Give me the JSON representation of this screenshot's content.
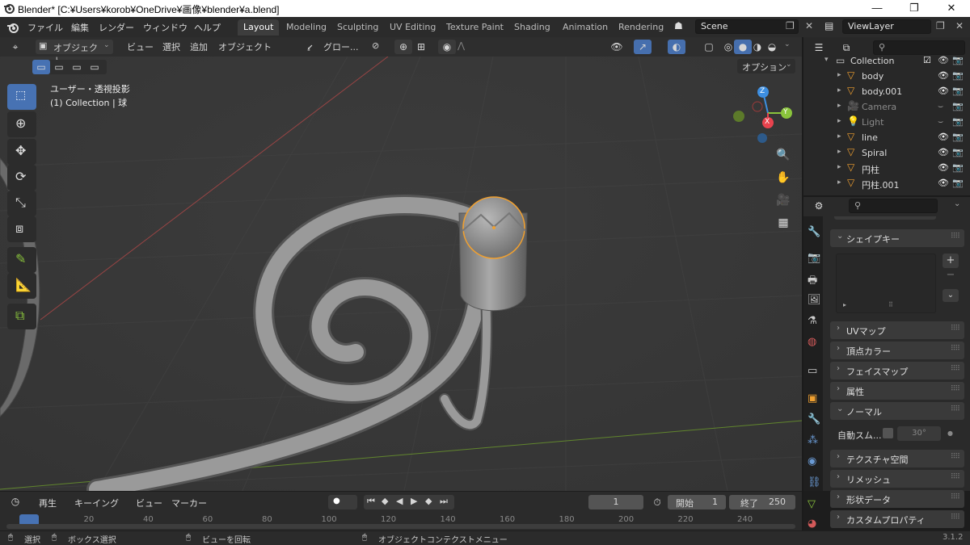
{
  "window": {
    "title": "Blender* [C:¥Users¥korob¥OneDrive¥画像¥blender¥a.blend]",
    "minimize": "—",
    "maximize": "❐",
    "close": "✕"
  },
  "menubar": {
    "items": [
      "ファイル",
      "編集",
      "レンダー",
      "ウィンドウ",
      "ヘルプ"
    ],
    "workspaces": [
      "Layout",
      "Modeling",
      "Sculpting",
      "UV Editing",
      "Texture Paint",
      "Shading",
      "Animation",
      "Rendering"
    ],
    "active_workspace": "Layout",
    "scene": "Scene",
    "view_layer": "ViewLayer"
  },
  "viewport_header": {
    "mode": "オブジェクト...",
    "menus": [
      "ビュー",
      "選択",
      "追加",
      "オブジェクト"
    ],
    "orientation": "グロー...",
    "options": "オプション"
  },
  "viewport": {
    "view_name": "ユーザー・透視投影",
    "collection_info": "(1) Collection | 球",
    "axis_x": "X",
    "axis_y": "Y",
    "axis_z": "Z"
  },
  "outliner": {
    "search_placeholder": "",
    "collection": "Collection",
    "rows": [
      {
        "name": "body",
        "dim": false
      },
      {
        "name": "body.001",
        "dim": false
      },
      {
        "name": "Camera",
        "dim": true
      },
      {
        "name": "Light",
        "dim": true
      },
      {
        "name": "line",
        "dim": false
      },
      {
        "name": "Spiral",
        "dim": false
      },
      {
        "name": "円柱",
        "dim": false
      },
      {
        "name": "円柱.001",
        "dim": false
      }
    ]
  },
  "properties": {
    "panels": [
      {
        "label": "シェイプキー",
        "open": true
      },
      {
        "label": "UVマップ",
        "open": false
      },
      {
        "label": "頂点カラー",
        "open": false
      },
      {
        "label": "フェイスマップ",
        "open": false
      },
      {
        "label": "属性",
        "open": false
      },
      {
        "label": "ノーマル",
        "open": true
      },
      {
        "label": "テクスチャ空間",
        "open": false
      },
      {
        "label": "リメッシュ",
        "open": false
      },
      {
        "label": "形状データ",
        "open": false
      },
      {
        "label": "カスタムプロパティ",
        "open": false
      }
    ],
    "auto_smooth_label": "自動スム...",
    "auto_smooth_angle": "30°"
  },
  "timeline": {
    "menus": [
      "再生",
      "キーイング",
      "ビュー",
      "マーカー"
    ],
    "current_frame": "1",
    "start_label": "開始",
    "start_value": "1",
    "end_label": "終了",
    "end_value": "250",
    "ticks": [
      "1",
      "20",
      "40",
      "60",
      "80",
      "100",
      "120",
      "140",
      "160",
      "180",
      "200",
      "220",
      "240"
    ]
  },
  "statusbar": {
    "select": "選択",
    "box_select": "ボックス選択",
    "rotate_view": "ビューを回転",
    "context_menu": "オブジェクトコンテクストメニュー",
    "version": "3.1.2"
  },
  "colors": {
    "accent": "#4772b3",
    "selection": "#f0a030",
    "axis_x": "#e8434e",
    "axis_y": "#8ac43c",
    "axis_z": "#3d8ee0"
  }
}
